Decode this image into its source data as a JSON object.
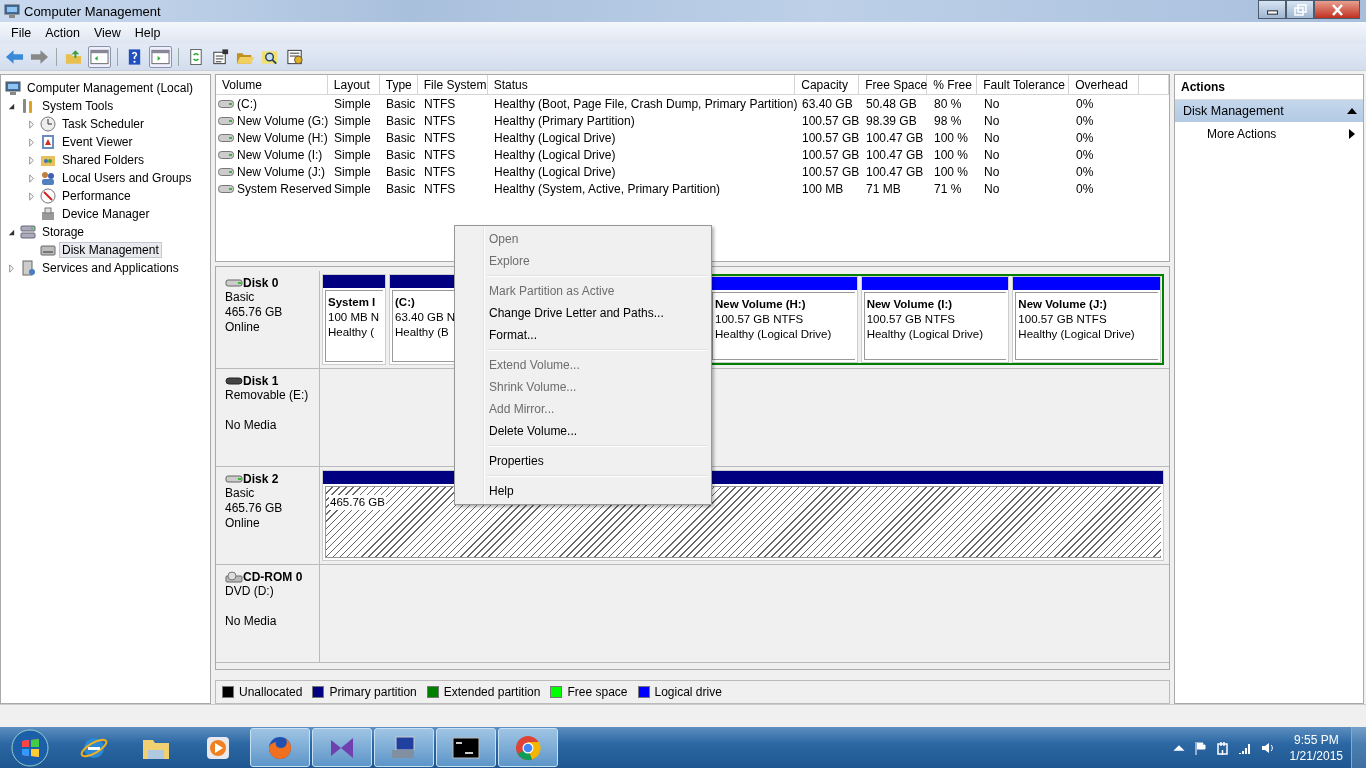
{
  "window": {
    "title": "Computer Management"
  },
  "menu": [
    "File",
    "Action",
    "View",
    "Help"
  ],
  "tree": [
    {
      "label": "Computer Management (Local)",
      "kind": "computer",
      "selected": false,
      "children": [
        {
          "label": "System Tools",
          "kind": "tools",
          "expanded": true,
          "selected": false,
          "children": [
            {
              "label": "Task Scheduler",
              "kind": "clock",
              "expanded": false,
              "selected": false
            },
            {
              "label": "Event Viewer",
              "kind": "log",
              "expanded": false,
              "selected": false
            },
            {
              "label": "Shared Folders",
              "kind": "share",
              "expanded": false,
              "selected": false
            },
            {
              "label": "Local Users and Groups",
              "kind": "users",
              "expanded": false,
              "selected": false
            },
            {
              "label": "Performance",
              "kind": "gauge",
              "expanded": false,
              "selected": false
            },
            {
              "label": "Device Manager",
              "kind": "device",
              "selected": false
            }
          ]
        },
        {
          "label": "Storage",
          "kind": "storage",
          "expanded": true,
          "selected": false,
          "children": [
            {
              "label": "Disk Management",
              "kind": "disk",
              "selected": true
            }
          ]
        },
        {
          "label": "Services and Applications",
          "kind": "services",
          "expanded": false,
          "selected": false
        }
      ]
    }
  ],
  "table": {
    "columns": [
      "Volume",
      "Layout",
      "Type",
      "File System",
      "Status",
      "Capacity",
      "Free Space",
      "% Free",
      "Fault Tolerance",
      "Overhead"
    ],
    "rows": [
      [
        "(C:)",
        "Simple",
        "Basic",
        "NTFS",
        "Healthy (Boot, Page File, Crash Dump, Primary Partition)",
        "63.40 GB",
        "50.48 GB",
        "80 %",
        "No",
        "0%"
      ],
      [
        "New Volume (G:)",
        "Simple",
        "Basic",
        "NTFS",
        "Healthy (Primary Partition)",
        "100.57 GB",
        "98.39 GB",
        "98 %",
        "No",
        "0%"
      ],
      [
        "New Volume (H:)",
        "Simple",
        "Basic",
        "NTFS",
        "Healthy (Logical Drive)",
        "100.57 GB",
        "100.47 GB",
        "100 %",
        "No",
        "0%"
      ],
      [
        "New Volume (I:)",
        "Simple",
        "Basic",
        "NTFS",
        "Healthy (Logical Drive)",
        "100.57 GB",
        "100.47 GB",
        "100 %",
        "No",
        "0%"
      ],
      [
        "New Volume (J:)",
        "Simple",
        "Basic",
        "NTFS",
        "Healthy (Logical Drive)",
        "100.57 GB",
        "100.47 GB",
        "100 %",
        "No",
        "0%"
      ],
      [
        "System Reserved",
        "Simple",
        "Basic",
        "NTFS",
        "Healthy (System, Active, Primary Partition)",
        "100 MB",
        "71 MB",
        "71 %",
        "No",
        "0%"
      ]
    ]
  },
  "disks": [
    {
      "name": "Disk 0",
      "kind": "hdd",
      "type": "Basic",
      "size": "465.76 GB",
      "status": "Online",
      "partitions": [
        {
          "kind": "primary",
          "lines": [
            "System I",
            "100 MB N",
            "Healthy ("
          ]
        },
        {
          "kind": "primary",
          "lines": [
            "(C:)",
            "63.40 GB N",
            "Healthy (B"
          ]
        },
        {
          "kind": "extended",
          "children": [
            {
              "kind": "logical",
              "lines": [
                "New Volume  (H:)",
                "100.57 GB NTFS",
                "Healthy (Logical Drive)"
              ]
            },
            {
              "kind": "logical",
              "lines": [
                "New Volume  (I:)",
                "100.57 GB NTFS",
                "Healthy (Logical Drive)"
              ]
            },
            {
              "kind": "logical",
              "lines": [
                "New Volume  (J:)",
                "100.57 GB NTFS",
                "Healthy (Logical Drive)"
              ]
            }
          ]
        }
      ]
    },
    {
      "name": "Disk 1",
      "kind": "removable",
      "type": "Removable (E:)",
      "status": "No Media"
    },
    {
      "name": "Disk 2",
      "kind": "hdd",
      "type": "Basic",
      "size": "465.76 GB",
      "status": "Online",
      "partitions": [
        {
          "kind": "primary",
          "hatched": true,
          "lines": [
            "465.76 GB"
          ]
        }
      ]
    },
    {
      "name": "CD-ROM 0",
      "kind": "cdrom",
      "type": "DVD (D:)",
      "status": "No Media"
    }
  ],
  "legend": [
    {
      "label": "Unallocated",
      "color": "#000000"
    },
    {
      "label": "Primary partition",
      "color": "#000080"
    },
    {
      "label": "Extended partition",
      "color": "#008000"
    },
    {
      "label": "Free space",
      "color": "#00ff00"
    },
    {
      "label": "Logical drive",
      "color": "#0000ff"
    }
  ],
  "actions": {
    "title": "Actions",
    "section": "Disk Management",
    "items": [
      "More Actions"
    ]
  },
  "context_menu": [
    [
      {
        "label": "Open",
        "disabled": true
      },
      {
        "label": "Explore",
        "disabled": true
      }
    ],
    [
      {
        "label": "Mark Partition as Active",
        "disabled": true
      },
      {
        "label": "Change Drive Letter and Paths...",
        "disabled": false
      },
      {
        "label": "Format...",
        "disabled": false
      }
    ],
    [
      {
        "label": "Extend Volume...",
        "disabled": true
      },
      {
        "label": "Shrink Volume...",
        "disabled": true
      },
      {
        "label": "Add Mirror...",
        "disabled": true
      },
      {
        "label": "Delete Volume...",
        "disabled": false
      }
    ],
    [
      {
        "label": "Properties",
        "disabled": false
      }
    ],
    [
      {
        "label": "Help",
        "disabled": false
      }
    ]
  ],
  "taskbar": {
    "apps": [
      {
        "kind": "ie",
        "open": false
      },
      {
        "kind": "folder",
        "open": false
      },
      {
        "kind": "media",
        "open": false
      },
      {
        "kind": "firefox",
        "open": true
      },
      {
        "kind": "vs",
        "open": true
      },
      {
        "kind": "network",
        "open": true
      },
      {
        "kind": "console",
        "open": true
      },
      {
        "kind": "chrome",
        "open": true
      }
    ],
    "time": "9:55 PM",
    "date": "1/21/2015"
  }
}
